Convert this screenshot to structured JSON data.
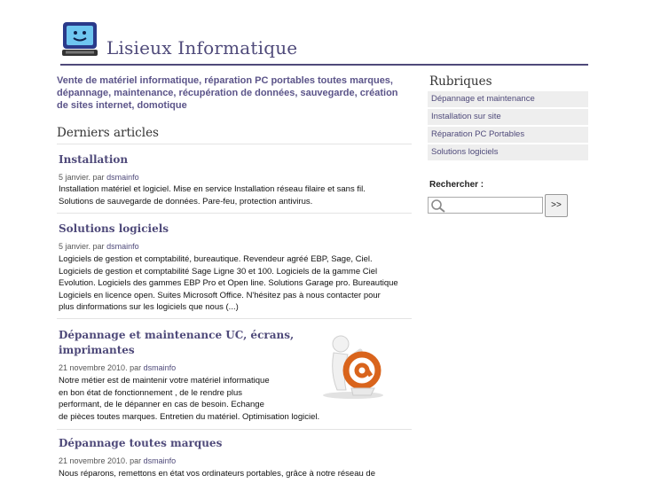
{
  "header": {
    "site_title": "Lisieux Informatique"
  },
  "tagline": "Vente de matériel informatique, réparation PC portables toutes marques, dépannage, maintenance, récupération de données, sauvegarde, création de sites internet, domotique",
  "main": {
    "section_title": "Derniers articles",
    "articles": [
      {
        "title": "Installation",
        "date": "5 janvier",
        "by": "par",
        "author": "dsmainfo",
        "lines": [
          "Installation matériel et logiciel. Mise en service Installation réseau filaire et sans fil.",
          "Solutions de sauvegarde de données. Pare-feu, protection antivirus."
        ]
      },
      {
        "title": "Solutions logiciels",
        "date": "5 janvier",
        "by": "par",
        "author": "dsmainfo",
        "lines": [
          "Logiciels de gestion et comptabilité, bureautique. Revendeur agréé EBP, Sage, Ciel.",
          "Logiciels de gestion et comptabilité Sage Ligne 30 et 100. Logiciels de la gamme Ciel",
          "Evolution. Logiciels des gammes EBP Pro et Open line. Solutions Garage pro. Bureautique",
          "Logiciels en licence open. Suites Microsoft Office. N'hésitez pas à nous contacter pour",
          "plus dinformations sur les logiciels que nous (...)"
        ]
      },
      {
        "title_line1": "Dépannage et maintenance UC, écrans,",
        "title_line2": "imprimantes",
        "date": "21 novembre 2010",
        "by": "par",
        "author": "dsmainfo",
        "lines": [
          "Notre métier est de maintenir votre matériel informatique",
          "en bon état de fonctionnement , de le rendre plus",
          "performant, de le dépanner en cas de besoin. Echange",
          "de pièces toutes marques. Entretien du matériel. Optimisation logiciel."
        ]
      },
      {
        "title": "Dépannage toutes marques",
        "date": "21 novembre 2010",
        "by": "par",
        "author": "dsmainfo",
        "lines": [
          "Nous réparons, remettons en état vos ordinateurs portables, grâce à notre réseau de"
        ]
      }
    ]
  },
  "sidebar": {
    "rubriques_title": "Rubriques",
    "rubriques": [
      "Dépannage et maintenance",
      "Installation sur site",
      "Réparation PC Portables",
      "Solutions logiciels"
    ],
    "search_label": "Rechercher :",
    "search_value": "",
    "search_button": ">>"
  },
  "colors": {
    "accent": "#4f4a7a",
    "item_bg": "#eeeeee"
  }
}
